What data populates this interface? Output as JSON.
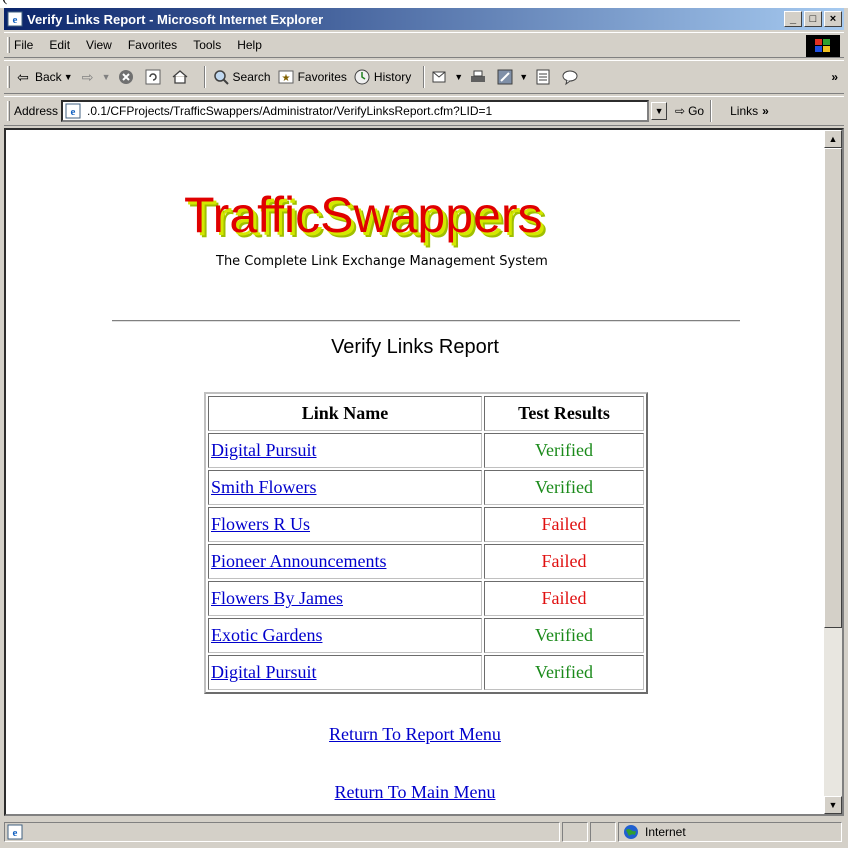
{
  "window": {
    "title": "Verify Links Report - Microsoft Internet Explorer",
    "controls": {
      "minimize": "_",
      "maximize": "□",
      "close": "×"
    }
  },
  "menubar": [
    "File",
    "Edit",
    "View",
    "Favorites",
    "Tools",
    "Help"
  ],
  "toolbar": {
    "back": "Back",
    "search": "Search",
    "favorites": "Favorites",
    "history": "History"
  },
  "address": {
    "label": "Address",
    "url": ".0.1/CFProjects/TrafficSwappers/Administrator/VerifyLinksReport.cfm?LID=1",
    "go": "Go",
    "links": "Links"
  },
  "page": {
    "logo": "TrafficSwappers",
    "tagline": "The Complete Link Exchange Management System",
    "title": "Verify Links Report",
    "table": {
      "headers": [
        "Link Name",
        "Test Results"
      ],
      "rows": [
        {
          "name": "Digital Pursuit",
          "result": "Verified"
        },
        {
          "name": "Smith Flowers",
          "result": "Verified"
        },
        {
          "name": "Flowers R Us",
          "result": "Failed"
        },
        {
          "name": "Pioneer Announcements",
          "result": "Failed"
        },
        {
          "name": "Flowers By James",
          "result": "Failed"
        },
        {
          "name": "Exotic Gardens",
          "result": "Verified"
        },
        {
          "name": "Digital Pursuit",
          "result": "Verified"
        }
      ]
    },
    "return_report": "Return To Report Menu",
    "return_main": "Return To Main Menu"
  },
  "status": {
    "zone": "Internet"
  },
  "colors": {
    "verified": "#1a8a1a",
    "failed": "#e01010",
    "link": "#0000cc"
  },
  "icons": [
    "ie-page-icon",
    "back-arrow-icon",
    "forward-arrow-icon",
    "stop-icon",
    "refresh-icon",
    "home-icon",
    "search-icon",
    "favorites-icon",
    "history-icon",
    "mail-icon",
    "print-icon",
    "edit-icon",
    "discuss-icon",
    "go-arrow-icon",
    "globe-icon",
    "windows-logo-icon"
  ]
}
